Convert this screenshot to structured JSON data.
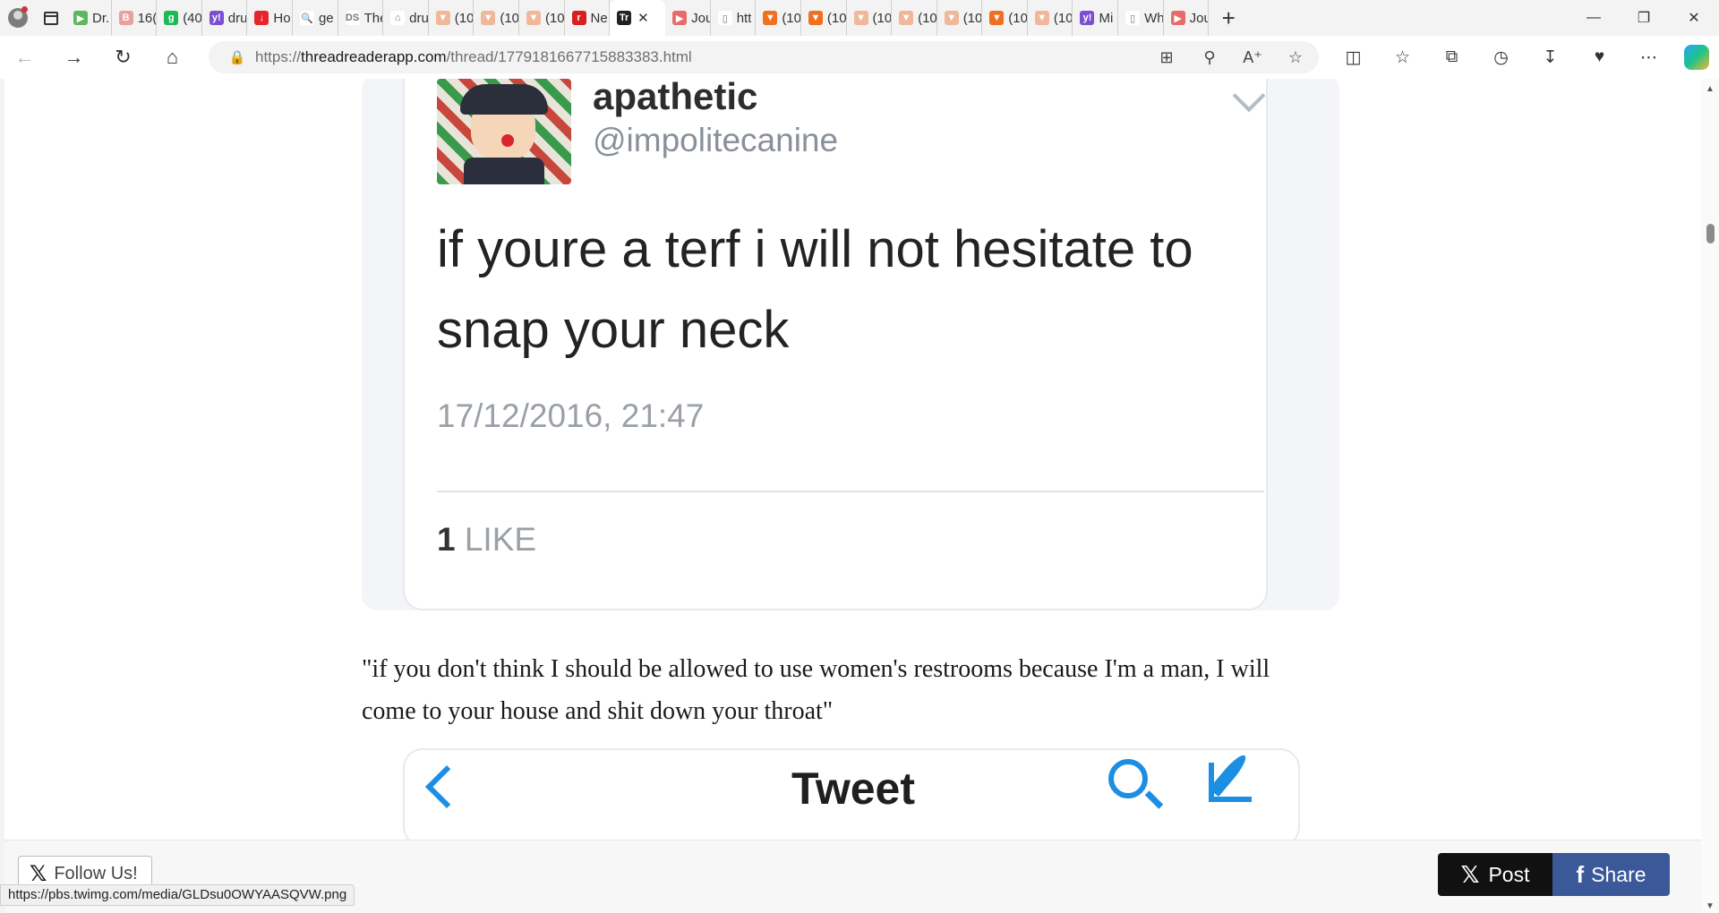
{
  "browser": {
    "tabs": [
      {
        "label": "Dr.",
        "fav": "▶",
        "color": "#5cb85c"
      },
      {
        "label": "16(",
        "fav": "B",
        "color": "#e8a0a0"
      },
      {
        "label": "(40",
        "fav": "g",
        "color": "#1db954"
      },
      {
        "label": "dru",
        "fav": "y!",
        "color": "#7b4fd1"
      },
      {
        "label": "Ho",
        "fav": "↓",
        "color": "#e5252a"
      },
      {
        "label": "ge",
        "fav": "🔍",
        "color": "#ffffff"
      },
      {
        "label": "The",
        "fav": "DS",
        "color": "#ffffff"
      },
      {
        "label": "dru",
        "fav": "⌂",
        "color": "#ffffff"
      },
      {
        "label": "(10",
        "fav": "▼",
        "color": "#f0b89a"
      },
      {
        "label": "(10",
        "fav": "▼",
        "color": "#f0b89a"
      },
      {
        "label": "(10",
        "fav": "▼",
        "color": "#f0b89a"
      },
      {
        "label": "Ne",
        "fav": "r",
        "color": "#d81e1e"
      }
    ],
    "active_tab": {
      "fav": "Tr",
      "color": "#222222"
    },
    "tabs_after": [
      {
        "label": "Jou",
        "fav": "▶",
        "color": "#e86a6a"
      },
      {
        "label": "htt",
        "fav": "▯",
        "color": "#ffffff"
      },
      {
        "label": "(10",
        "fav": "▼",
        "color": "#f07020"
      },
      {
        "label": "(10",
        "fav": "▼",
        "color": "#f07020"
      },
      {
        "label": "(10",
        "fav": "▼",
        "color": "#f0b89a"
      },
      {
        "label": "(10",
        "fav": "▼",
        "color": "#f0b89a"
      },
      {
        "label": "(10",
        "fav": "▼",
        "color": "#f0b89a"
      },
      {
        "label": "(10",
        "fav": "▼",
        "color": "#f07020"
      },
      {
        "label": "(10",
        "fav": "▼",
        "color": "#f0b89a"
      },
      {
        "label": "Mi",
        "fav": "y!",
        "color": "#7b4fd1"
      },
      {
        "label": "Wh",
        "fav": "▯",
        "color": "#ffffff"
      },
      {
        "label": "Jou",
        "fav": "▶",
        "color": "#e86a6a"
      }
    ],
    "url_prefix": "https://",
    "url_host": "threadreaderapp.com",
    "url_path": "/thread/1779181667715883383.html"
  },
  "tweet1": {
    "username": "apathetic",
    "handle": "@impolitecanine",
    "text": "if youre a terf i will not hesitate to snap your neck",
    "date": "17/12/2016, 21:47",
    "likes_count": "1",
    "likes_label": "LIKE"
  },
  "quote": "\"if you don't think I should be allowed to use women's restrooms because I'm a man, I will come to your house and shit down your throat\"",
  "tweet2": {
    "title": "Tweet"
  },
  "footer": {
    "follow_label": "Follow Us!",
    "post_label": "Post",
    "share_label": "Share"
  },
  "status_url": "https://pbs.twimg.com/media/GLDsu0OWYAASQVW.png"
}
